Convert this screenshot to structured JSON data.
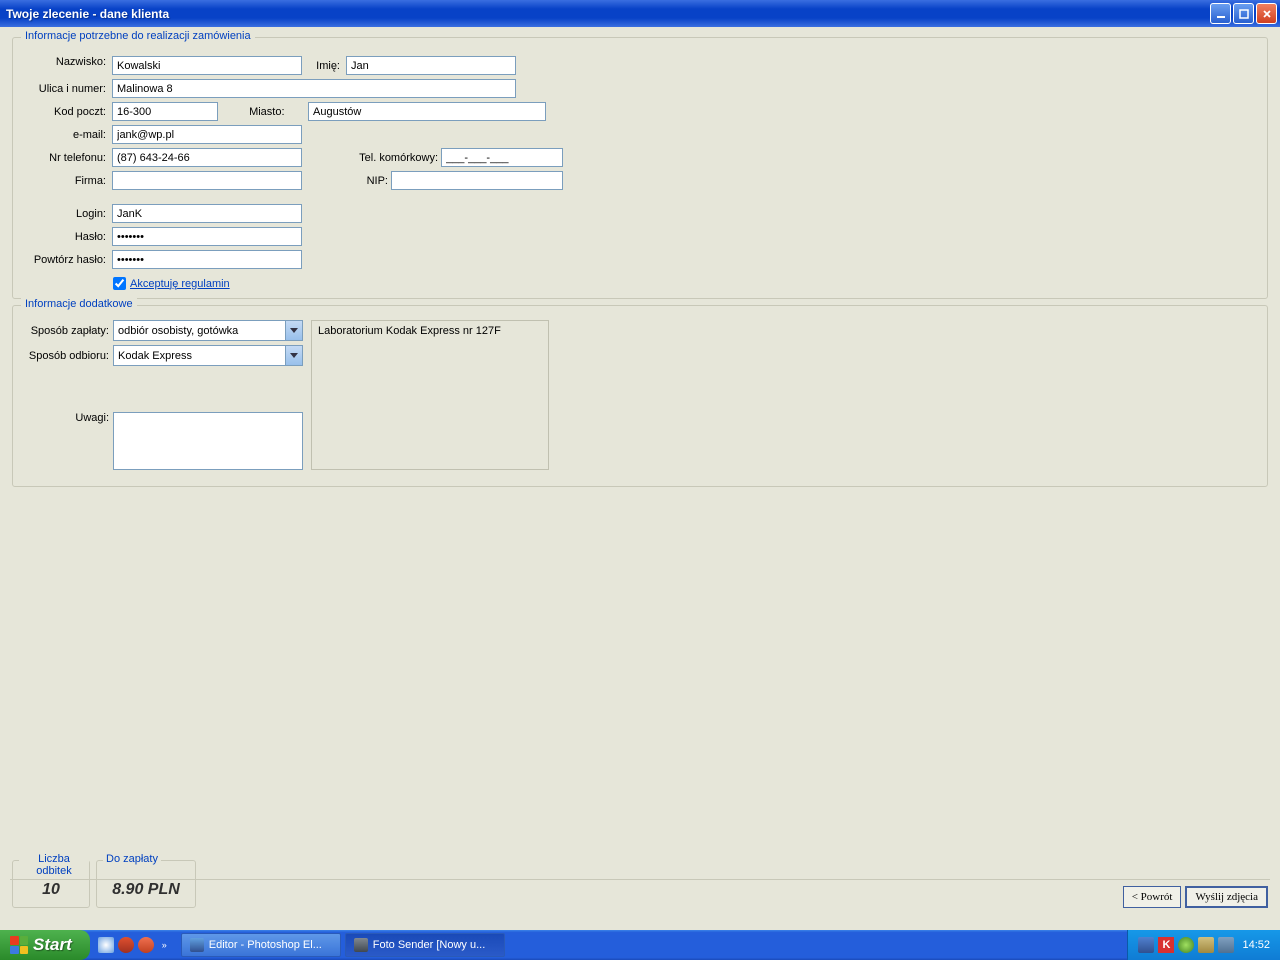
{
  "window": {
    "title": "Twoje zlecenie - dane klienta"
  },
  "groups": {
    "customerInfo": "Informacje potrzebne do realizacji zamówienia",
    "additionalInfo": "Informacje dodatkowe"
  },
  "labels": {
    "surname": "Nazwisko:",
    "firstName": "Imię:",
    "street": "Ulica i numer:",
    "zip": "Kod poczt:",
    "city": "Miasto:",
    "email": "e-mail:",
    "phone": "Nr telefonu:",
    "mobile": "Tel. komórkowy:",
    "company": "Firma:",
    "nip": "NIP:",
    "login": "Login:",
    "password": "Hasło:",
    "passwordRepeat": "Powtórz hasło:",
    "acceptTerms": "Akceptuję regulamin",
    "paymentMethod": "Sposób zapłaty:",
    "deliveryMethod": "Sposób odbioru:",
    "notes": "Uwagi:"
  },
  "values": {
    "surname": "Kowalski",
    "firstName": "Jan",
    "street": "Malinowa 8",
    "zip": "16-300",
    "city": "Augustów",
    "email": "jank@wp.pl",
    "phone": "(87) 643-24-66",
    "mobile": "___-___-___",
    "company": "",
    "nip": "",
    "login": "JanK",
    "password": "•••••••",
    "passwordRepeat": "•••••••",
    "acceptTerms": true,
    "paymentMethod": "odbiór osobisty, gotówka",
    "deliveryMethod": "Kodak Express",
    "notes": "",
    "labInfo": "Laboratorium Kodak Express nr 127F"
  },
  "summary": {
    "countLabel": "Liczba odbitek",
    "countValue": "10",
    "payLabel": "Do zapłaty",
    "payValue": "8.90 PLN"
  },
  "buttons": {
    "back": "< Powrót",
    "send": "Wyślij zdjęcia"
  },
  "taskbar": {
    "start": "Start",
    "task1": "Editor - Photoshop El...",
    "task2": "Foto Sender [Nowy u...",
    "time": "14:52"
  }
}
